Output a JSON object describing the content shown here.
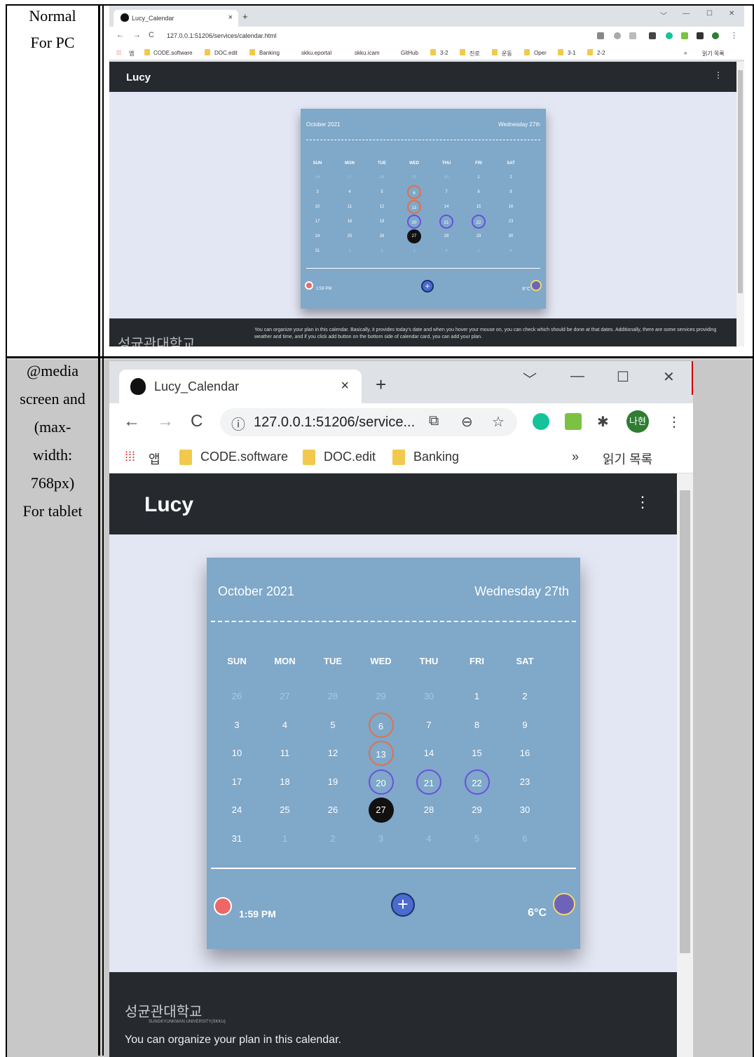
{
  "labels": {
    "row1": [
      "Normal",
      "For PC"
    ],
    "row2": [
      "@media",
      "screen and",
      "(max-",
      "width:",
      "768px)",
      "For tablet"
    ]
  },
  "browser": {
    "tab_title": "Lucy_Calendar",
    "close": "×",
    "new_tab": "+",
    "win_min": "—",
    "win_max": "☐",
    "win_close": "✕",
    "win_menu": "﹀",
    "back": "←",
    "forward": "→",
    "reload": "C",
    "url_pc": "127.0.0.1:51206/services/calendar.html",
    "url_tablet": "127.0.0.1:51206/service...",
    "profile": "나현",
    "more": "⋮",
    "reading_list": "읽기 목록",
    "overflow": "»"
  },
  "bookmarks_pc": [
    "앱",
    "CODE.software",
    "DOC.edit",
    "Banking",
    "skku.eportal",
    "skku.icam",
    "GitHub",
    "3-2",
    "진로",
    "운동",
    "Oper",
    "3-1",
    "2-2"
  ],
  "bookmarks_tablet": [
    "앱",
    "CODE.software",
    "DOC.edit",
    "Banking"
  ],
  "app": {
    "brand": "Lucy",
    "menu": "⋮",
    "month": "October 2021",
    "date": "Wednesday 27th",
    "weekdays": [
      "SUN",
      "MON",
      "TUE",
      "WED",
      "THU",
      "FRI",
      "SAT"
    ],
    "days": [
      [
        "26",
        "27",
        "28",
        "29",
        "30",
        "1",
        "2"
      ],
      [
        "3",
        "4",
        "5",
        "6",
        "7",
        "8",
        "9"
      ],
      [
        "10",
        "11",
        "12",
        "13",
        "14",
        "15",
        "16"
      ],
      [
        "17",
        "18",
        "19",
        "20",
        "21",
        "22",
        "23"
      ],
      [
        "24",
        "25",
        "26",
        "27",
        "28",
        "29",
        "30"
      ],
      [
        "31",
        "1",
        "2",
        "3",
        "4",
        "5",
        "6"
      ]
    ],
    "time": "1:59 PM",
    "temp": "6°C",
    "add": "+",
    "footer_logo": "성균관대학교",
    "footer_logo_sub": "SUNGKYUNKWAN UNIVERSITY(SKKU)",
    "footer_text_pc": "You can organize your plan in this calendar. Basically, it provides today's date and when you hover your mouse on, you can check which should be done at that dates. Additionally, there are some services providing weather and time, and if you click add button on the bottom side of calendar card, you can add your plan.",
    "footer_text_tablet": "You can organize your plan in this calendar."
  },
  "colors": {
    "card": "#7fa8c9",
    "page": "#e3e6f3",
    "header": "#262a2f",
    "ring_orange": "#e0714a",
    "ring_purple": "#6b4fe0",
    "today": "#111111"
  }
}
